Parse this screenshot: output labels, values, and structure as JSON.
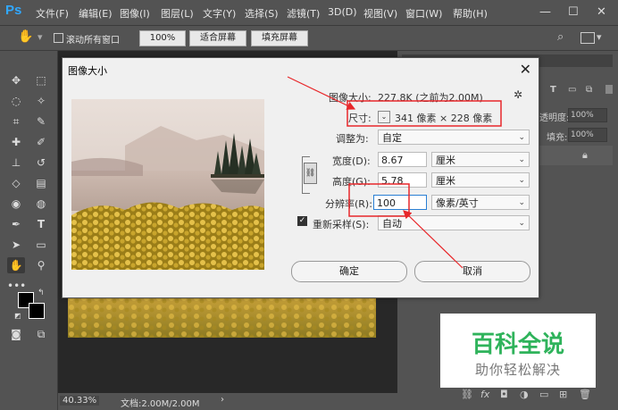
{
  "app": {
    "logo": "Ps",
    "menu": [
      "文件(F)",
      "编辑(E)",
      "图像(I)",
      "图层(L)",
      "文字(Y)",
      "选择(S)",
      "滤镜(T)",
      "3D(D)",
      "视图(V)",
      "窗口(W)",
      "帮助(H)"
    ],
    "window_controls": [
      "—",
      "☐",
      "✕"
    ]
  },
  "options_bar": {
    "scroll_all_label": "滚动所有窗口",
    "zoom_100": "100%",
    "fit_screen": "适合屏幕",
    "fill_screen": "填充屏幕"
  },
  "status_bar": {
    "zoom": "40.33%",
    "doc_info": "文档:2.00M/2.00M"
  },
  "right_panel": {
    "opacity_label": "不透明度:",
    "opacity_value": "100%",
    "fill_label": "填充:",
    "fill_value": "100%"
  },
  "dialog": {
    "title": "图像大小",
    "image_size_label": "图像大小:",
    "image_size_value": "227.8K (之前为2.00M)",
    "dimensions_label": "尺寸:",
    "dimensions_value": "341 像素 × 228 像素",
    "fit_label": "调整为:",
    "fit_value": "自定",
    "width_label": "宽度(D):",
    "width_value": "8.67",
    "width_unit": "厘米",
    "height_label": "高度(G):",
    "height_value": "5.78",
    "height_unit": "厘米",
    "resolution_label": "分辨率(R):",
    "resolution_value": "100",
    "resolution_unit": "像素/英寸",
    "resample_label": "重新采样(S):",
    "resample_value": "自动",
    "ok": "确定",
    "cancel": "取消"
  },
  "watermark": {
    "title": "百科全说",
    "subtitle": "助你轻松解决"
  },
  "colors": {
    "ps_blue": "#31a8ff",
    "annotation_red": "#e8272a",
    "watermark_green": "#2fb35b"
  }
}
